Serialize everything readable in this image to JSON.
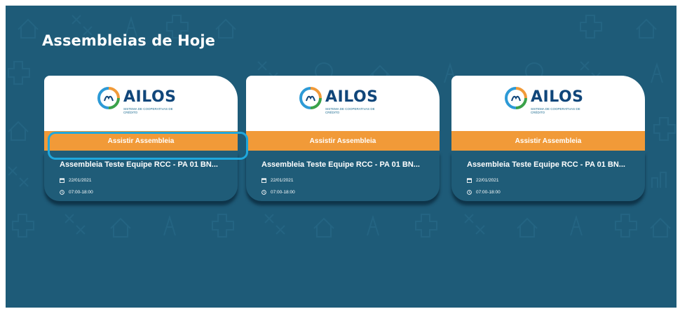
{
  "page": {
    "title": "Assembleias de Hoje"
  },
  "colors": {
    "background": "#1e5b78",
    "card_button": "#f19a38",
    "highlight": "#1fa7dc",
    "logo_text": "#10467a"
  },
  "cards": [
    {
      "logo": {
        "name": "AILOS",
        "subtitle": "SISTEMA DE COOPERATIVAS DE CRÉDITO"
      },
      "button_label": "Assistir Assembleia",
      "title": "Assembleia Teste Equipe RCC - PA 01 BN...",
      "date": "22/01/2021",
      "time": "07:00-18:00",
      "date_icon": "calendar-icon",
      "time_icon": "clock-icon",
      "highlighted": true
    },
    {
      "logo": {
        "name": "AILOS",
        "subtitle": "SISTEMA DE COOPERATIVAS DE CRÉDITO"
      },
      "button_label": "Assistir Assembleia",
      "title": "Assembleia Teste Equipe RCC - PA 01 BN...",
      "date": "22/01/2021",
      "time": "07:00-18:00",
      "date_icon": "calendar-icon",
      "time_icon": "clock-icon",
      "highlighted": false
    },
    {
      "logo": {
        "name": "AILOS",
        "subtitle": "SISTEMA DE COOPERATIVAS DE CRÉDITO"
      },
      "button_label": "Assistir Assembleia",
      "title": "Assembleia Teste Equipe RCC - PA 01 BN...",
      "date": "22/01/2021",
      "time": "07:00-18:00",
      "date_icon": "calendar-icon",
      "time_icon": "clock-icon",
      "highlighted": false
    }
  ]
}
